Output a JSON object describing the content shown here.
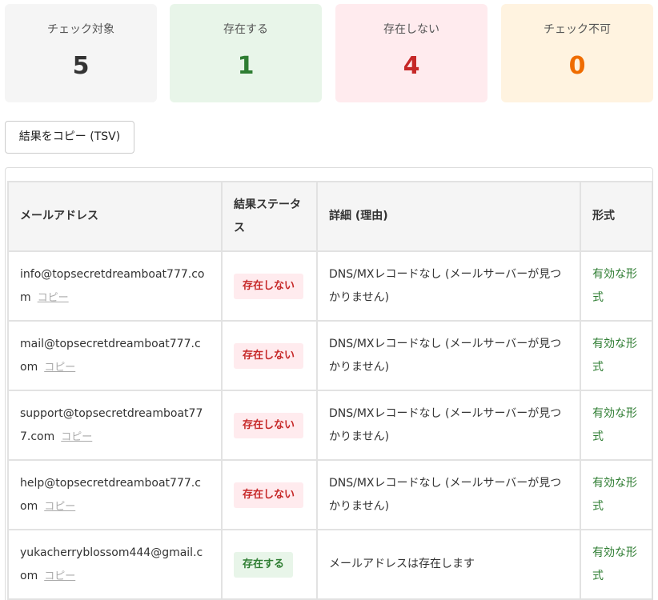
{
  "summary": {
    "checked": {
      "label": "チェック対象",
      "value": "5"
    },
    "exists": {
      "label": "存在する",
      "value": "1"
    },
    "not_exists": {
      "label": "存在しない",
      "value": "4"
    },
    "uncheckable": {
      "label": "チェック不可",
      "value": "0"
    }
  },
  "toolbar": {
    "copy_label": "結果をコピー (TSV)"
  },
  "table": {
    "headers": [
      "メールアドレス",
      "結果ステータス",
      "詳細 (理由)",
      "形式"
    ],
    "copy_link": "コピー",
    "rows": [
      {
        "email": "info@topsecretdreamboat777.com",
        "status": "存在しない",
        "status_type": "ng",
        "detail": "DNS/MXレコードなし (メールサーバーが見つかりません)",
        "format": "有効な形式"
      },
      {
        "email": "mail@topsecretdreamboat777.com",
        "status": "存在しない",
        "status_type": "ng",
        "detail": "DNS/MXレコードなし (メールサーバーが見つかりません)",
        "format": "有効な形式"
      },
      {
        "email": "support@topsecretdreamboat777.com",
        "status": "存在しない",
        "status_type": "ng",
        "detail": "DNS/MXレコードなし (メールサーバーが見つかりません)",
        "format": "有効な形式"
      },
      {
        "email": "help@topsecretdreamboat777.com",
        "status": "存在しない",
        "status_type": "ng",
        "detail": "DNS/MXレコードなし (メールサーバーが見つかりません)",
        "format": "有効な形式"
      },
      {
        "email": "yukacherryblossom444@gmail.com",
        "status": "存在する",
        "status_type": "ok",
        "detail": "メールアドレスは存在します",
        "format": "有効な形式"
      }
    ]
  }
}
